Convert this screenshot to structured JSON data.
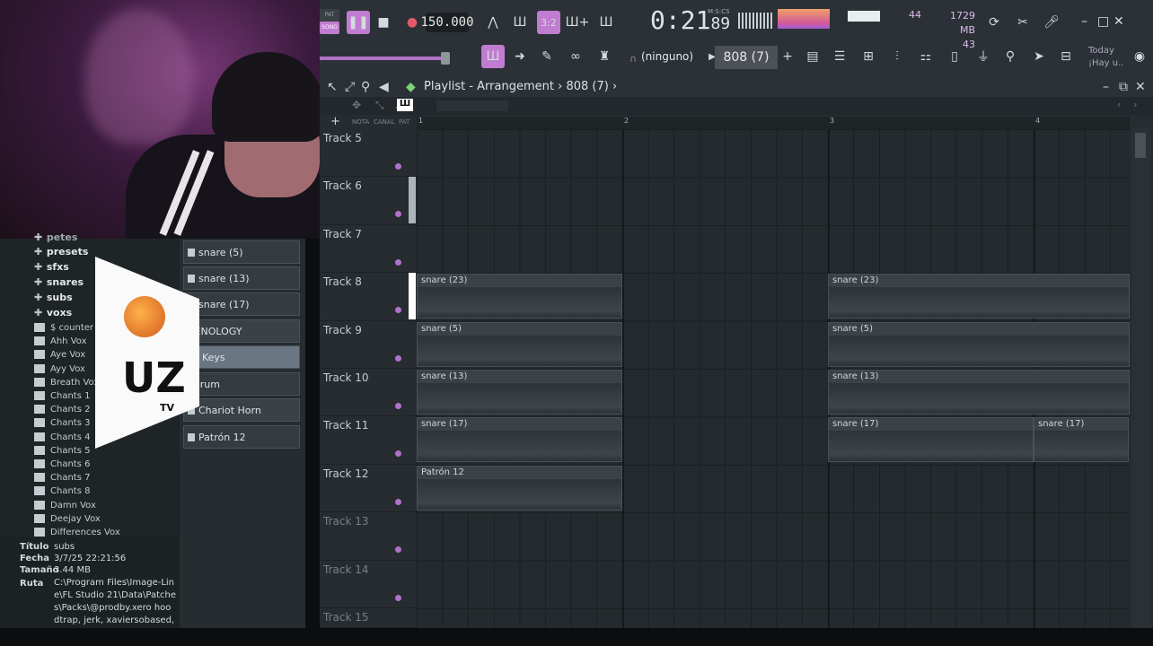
{
  "transport": {
    "mode_pat": "PAT",
    "mode_song": "SONG",
    "tempo": "150.000",
    "time": "0:21",
    "time_ms": "89",
    "time_unit": "M:S:CS",
    "cpu": "44",
    "memory": "1729 MB",
    "polyphony": "43",
    "pattern": "808 (7)",
    "pattern_prev": "(ninguno)",
    "hint_title": "Today",
    "hint_text": "¡Hay u.."
  },
  "playlist": {
    "title": "Playlist - Arrangement",
    "breadcrumb": "808 (7)",
    "sub_labels": [
      "NOTA",
      "CANAL",
      "PAT"
    ],
    "bars": [
      "1",
      "2",
      "3",
      "4"
    ],
    "tracks": [
      "Track 5",
      "Track 6",
      "Track 7",
      "Track 8",
      "Track 9",
      "Track 10",
      "Track 11",
      "Track 12",
      "Track 13",
      "Track 14",
      "Track 15"
    ],
    "clips": [
      {
        "track": 3,
        "bar": 1,
        "label": "snare (23)"
      },
      {
        "track": 3,
        "bar": 3,
        "label": "snare (23)"
      },
      {
        "track": 4,
        "bar": 1,
        "label": "snare (5)"
      },
      {
        "track": 4,
        "bar": 3,
        "label": "snare (5)"
      },
      {
        "track": 5,
        "bar": 1,
        "label": "snare (13)"
      },
      {
        "track": 5,
        "bar": 3,
        "label": "snare (13)"
      },
      {
        "track": 6,
        "bar": 1,
        "label": "snare (17)"
      },
      {
        "track": 6,
        "bar": 3,
        "label": "snare (17)"
      },
      {
        "track": 6,
        "bar": 4,
        "label": "snare (17)"
      },
      {
        "track": 7,
        "bar": 1,
        "label": "Patrón 12"
      }
    ]
  },
  "browser": {
    "folders": [
      "petes",
      "presets",
      "sfxs",
      "snares",
      "subs",
      "voxs"
    ],
    "files": [
      "$ counter b",
      "Ahh Vox",
      "Aye Vox",
      "Ayy Vox",
      "Breath Vox",
      "Chants 1",
      "Chants 2",
      "Chants 3",
      "Chants 4",
      "Chants 5",
      "Chants 6",
      "Chants 7",
      "Chants 8",
      "Damn Vox",
      "Deejay Vox",
      "Differences Vox"
    ],
    "meta": {
      "titulo_k": "Título",
      "titulo_v": "subs",
      "fecha_k": "Fecha",
      "fecha_v": "3/7/25 22:21:56",
      "tamano_k": "Tamaño",
      "tamano_v": "3.44 MB",
      "ruta_k": "Ruta",
      "ruta_v": "C:\\Program Files\\Image-Line\\FL Studio 21\\Data\\Patches\\Packs\\@prodby.xero hoodtrap, jerk, xaviersobased,"
    }
  },
  "channels": [
    "snare (5)",
    "snare (13)",
    "snare (17)",
    "ZENOLOGY",
    "FL Keys",
    "Serum",
    "Chariot Horn",
    "Patrón 12"
  ],
  "logo": {
    "text": "UZ",
    "sub": "TV"
  },
  "colors": {
    "accent": "#b072c8",
    "panel": "#262c30",
    "toolbar": "#2b3136"
  }
}
